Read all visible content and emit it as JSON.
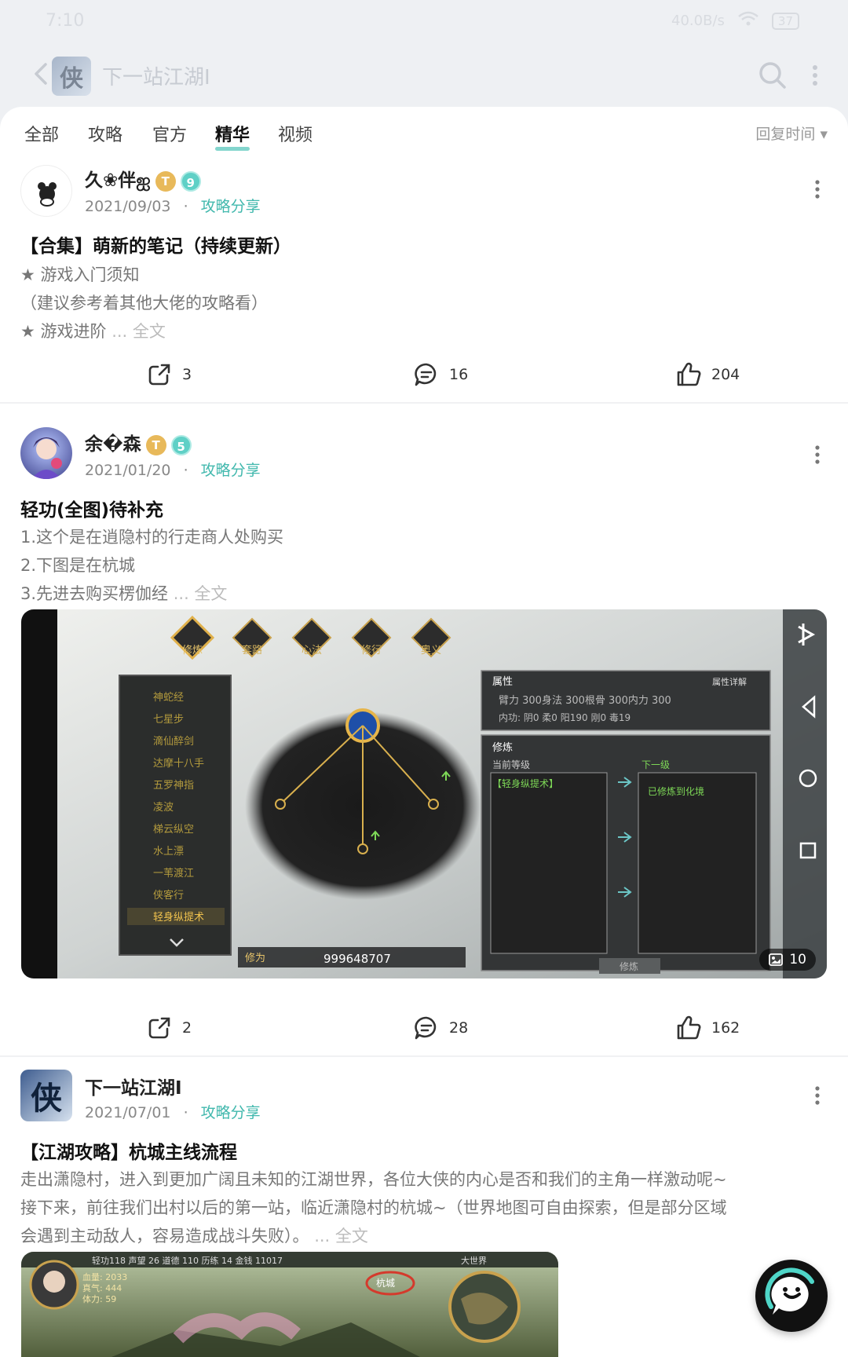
{
  "status": {
    "time": "7:10",
    "signal": "40.0B/s",
    "battery": "37"
  },
  "header": {
    "title": "下一站江湖Ⅰ",
    "logo_glyph": "侠"
  },
  "tabs": [
    {
      "label": "全部"
    },
    {
      "label": "攻略"
    },
    {
      "label": "官方"
    },
    {
      "label": "精华",
      "active": true
    },
    {
      "label": "视频"
    }
  ],
  "sort": {
    "label": "回复时间 ▾"
  },
  "posts": [
    {
      "user": "久❀伴ஐ",
      "badge_t": "T",
      "level": "9",
      "date": "2021/09/03",
      "dot": "·",
      "category": "攻略分享",
      "title": "【合集】萌新的笔记（持续更新）",
      "lines": [
        "★ 游戏入门须知",
        "（建议参考着其他大佬的攻略看）",
        "★ 游戏进阶"
      ],
      "more": "... 全文",
      "shares": "3",
      "comments": "16",
      "likes": "204"
    },
    {
      "user": "余�森",
      "badge_t": "T",
      "level": "5",
      "date": "2021/01/20",
      "dot": "·",
      "category": "攻略分享",
      "title": "轻功(全图)待补充",
      "lines": [
        "1.这个是在逍隐村的行走商人处购买",
        "2.下图是在杭城",
        "3.先进去购买楞伽经"
      ],
      "more": "... 全文",
      "image_count": "10",
      "shares": "2",
      "comments": "28",
      "likes": "162",
      "game": {
        "tabs": [
          "修炼",
          "套路",
          "心法",
          "修行",
          "奥义"
        ],
        "skills": [
          "神蛇经",
          "七星步",
          "滴仙醉剑",
          "达摩十八手",
          "五罗神指",
          "凌波",
          "梯云纵空",
          "水上漂",
          "一苇渡江",
          "侠客行",
          "轻身纵提术"
        ],
        "xiuwei_label": "修为",
        "xiuwei": "999648707",
        "attr_title": "属性",
        "attr_detail": "属性详解",
        "attr_row": "臂力 300身法 300根骨 300内力 300",
        "neigong": "内功: 阴0 柔0 阳190 刚0 毒19",
        "train_title": "修炼",
        "current_level": "当前等级",
        "next_level": "下一级",
        "skill_name": "【轻身纵提术】",
        "maxed": "已修炼到化境",
        "train_btn": "修炼"
      }
    },
    {
      "user": "下一站江湖Ⅰ",
      "date": "2021/07/01",
      "dot": "·",
      "category": "攻略分享",
      "title": "【江湖攻略】杭城主线流程",
      "lines": [
        "走出潇隐村，进入到更加广阔且未知的江湖世界，各位大侠的内心是否和我们的主角一样激动呢~",
        "接下来，前往我们出村以后的第一站，临近潇隐村的杭城~（世界地图可自由探索，但是部分区域",
        "会遇到主动敌人，容易造成战斗失败）。"
      ],
      "more": "... 全文",
      "game": {
        "hud": "轻功118  声望 26  道德 110  历练 14  金钱 11017",
        "hp": "血量: 2033",
        "mp": "真气: 444",
        "stamina": "体力: 59",
        "map_label": "大世界",
        "city": "杭城"
      }
    }
  ],
  "colors": {
    "accent": "#41b8ad",
    "badge_gold": "#e8b95a"
  }
}
